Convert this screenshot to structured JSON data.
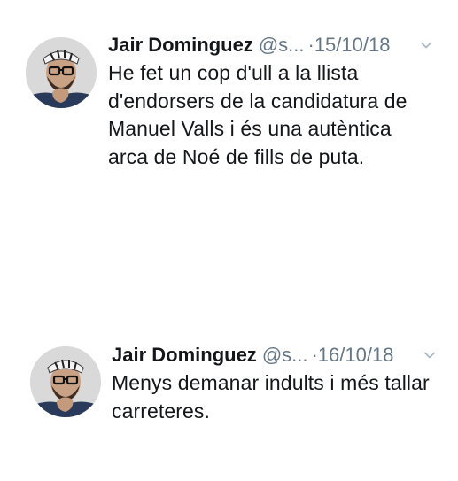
{
  "tweets": [
    {
      "avatar_icon": "user-avatar-photo",
      "author_name": "Jair Dominguez",
      "handle": "@s...",
      "separator": "·",
      "date": "15/10/18",
      "menu_icon": "chevron-down-icon",
      "text": "He fet un cop d'ull a la llista d'endorsers de la candidatura de Manuel Valls i és una autèntica arca de Noé de fills de puta."
    },
    {
      "avatar_icon": "user-avatar-photo",
      "author_name": "Jair Dominguez",
      "handle": "@s...",
      "separator": "·",
      "date": "16/10/18",
      "menu_icon": "chevron-down-icon",
      "text": "Menys demanar indults i més tallar carreteres."
    }
  ],
  "colors": {
    "primary_text": "#14171a",
    "secondary_text": "#657786",
    "background": "#ffffff"
  }
}
